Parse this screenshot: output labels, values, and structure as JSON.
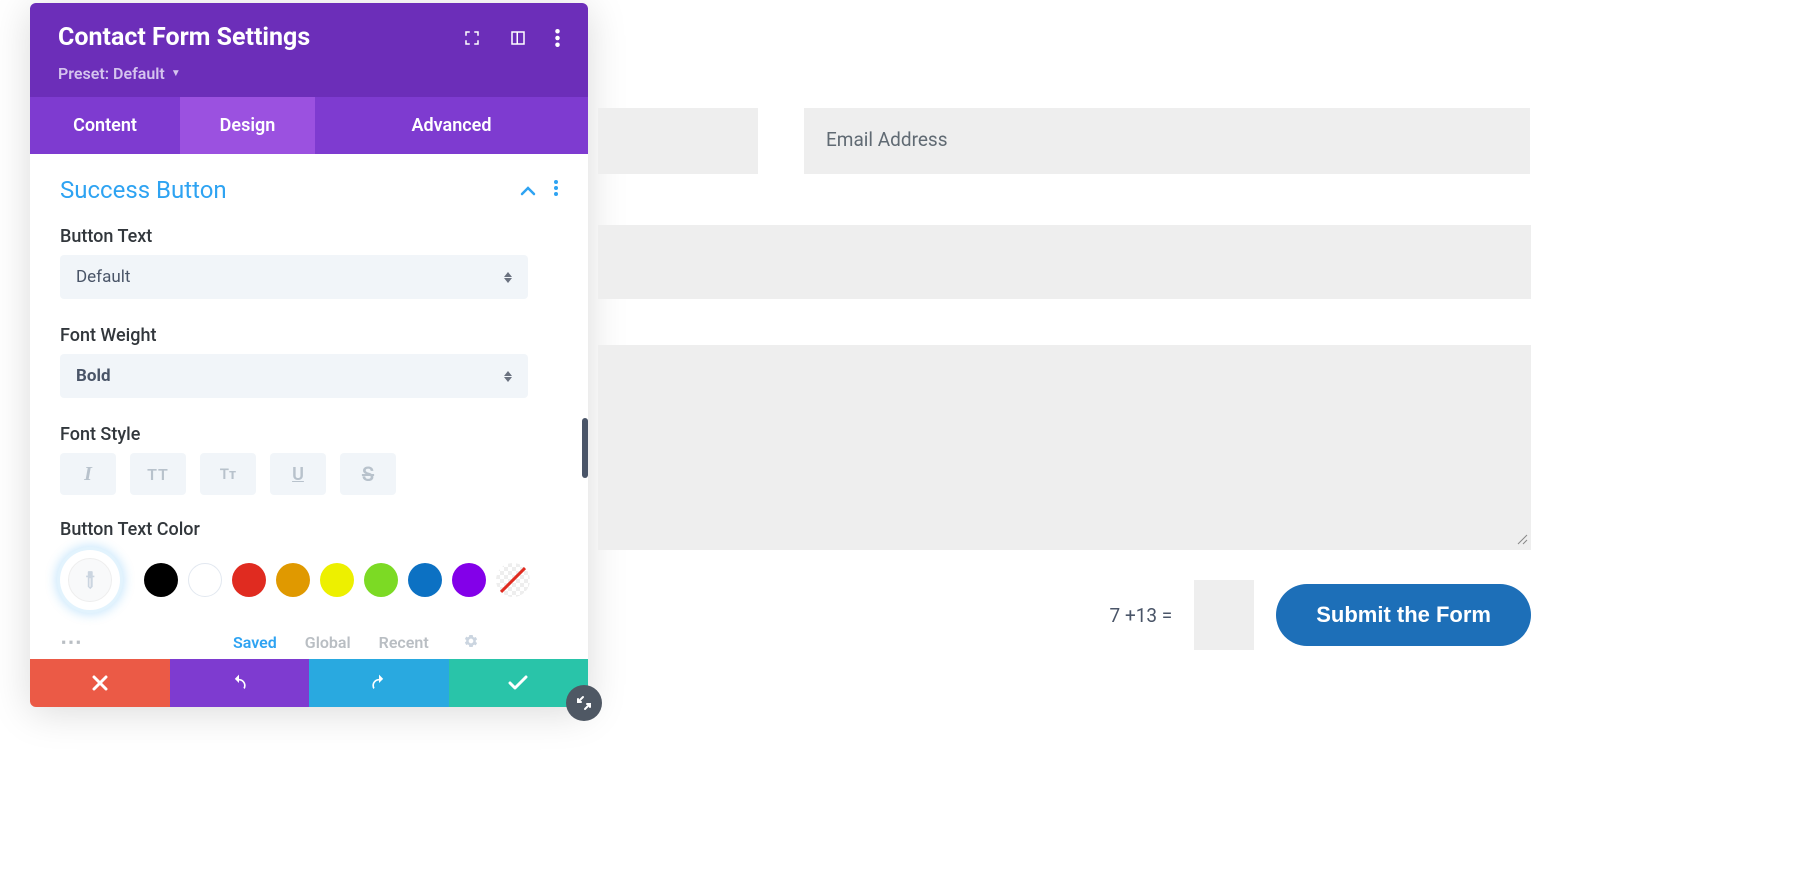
{
  "panel": {
    "title": "Contact Form Settings",
    "preset_label": "Preset: Default",
    "tabs": {
      "content": "Content",
      "design": "Design",
      "advanced": "Advanced"
    },
    "section_title": "Success Button",
    "labels": {
      "button_text": "Button Text",
      "font_weight": "Font Weight",
      "font_style": "Font Style",
      "button_text_color": "Button Text Color"
    },
    "button_text_value": "Default",
    "font_weight_value": "Bold",
    "style_buttons": {
      "italic": "I",
      "uppercase": "TT",
      "smallcaps": "Tᴛ",
      "underline": "U",
      "strikethrough": "S"
    },
    "swatches": [
      "#000000",
      "#ffffff",
      "#e02b20",
      "#e09900",
      "#edf000",
      "#7cda24",
      "#0c71c3",
      "#8300e9"
    ],
    "bottom_tabs": {
      "saved": "Saved",
      "global": "Global",
      "recent": "Recent"
    }
  },
  "form": {
    "email_placeholder": "Email Address",
    "captcha": "7 +13 =",
    "submit_label": "Submit the Form"
  }
}
